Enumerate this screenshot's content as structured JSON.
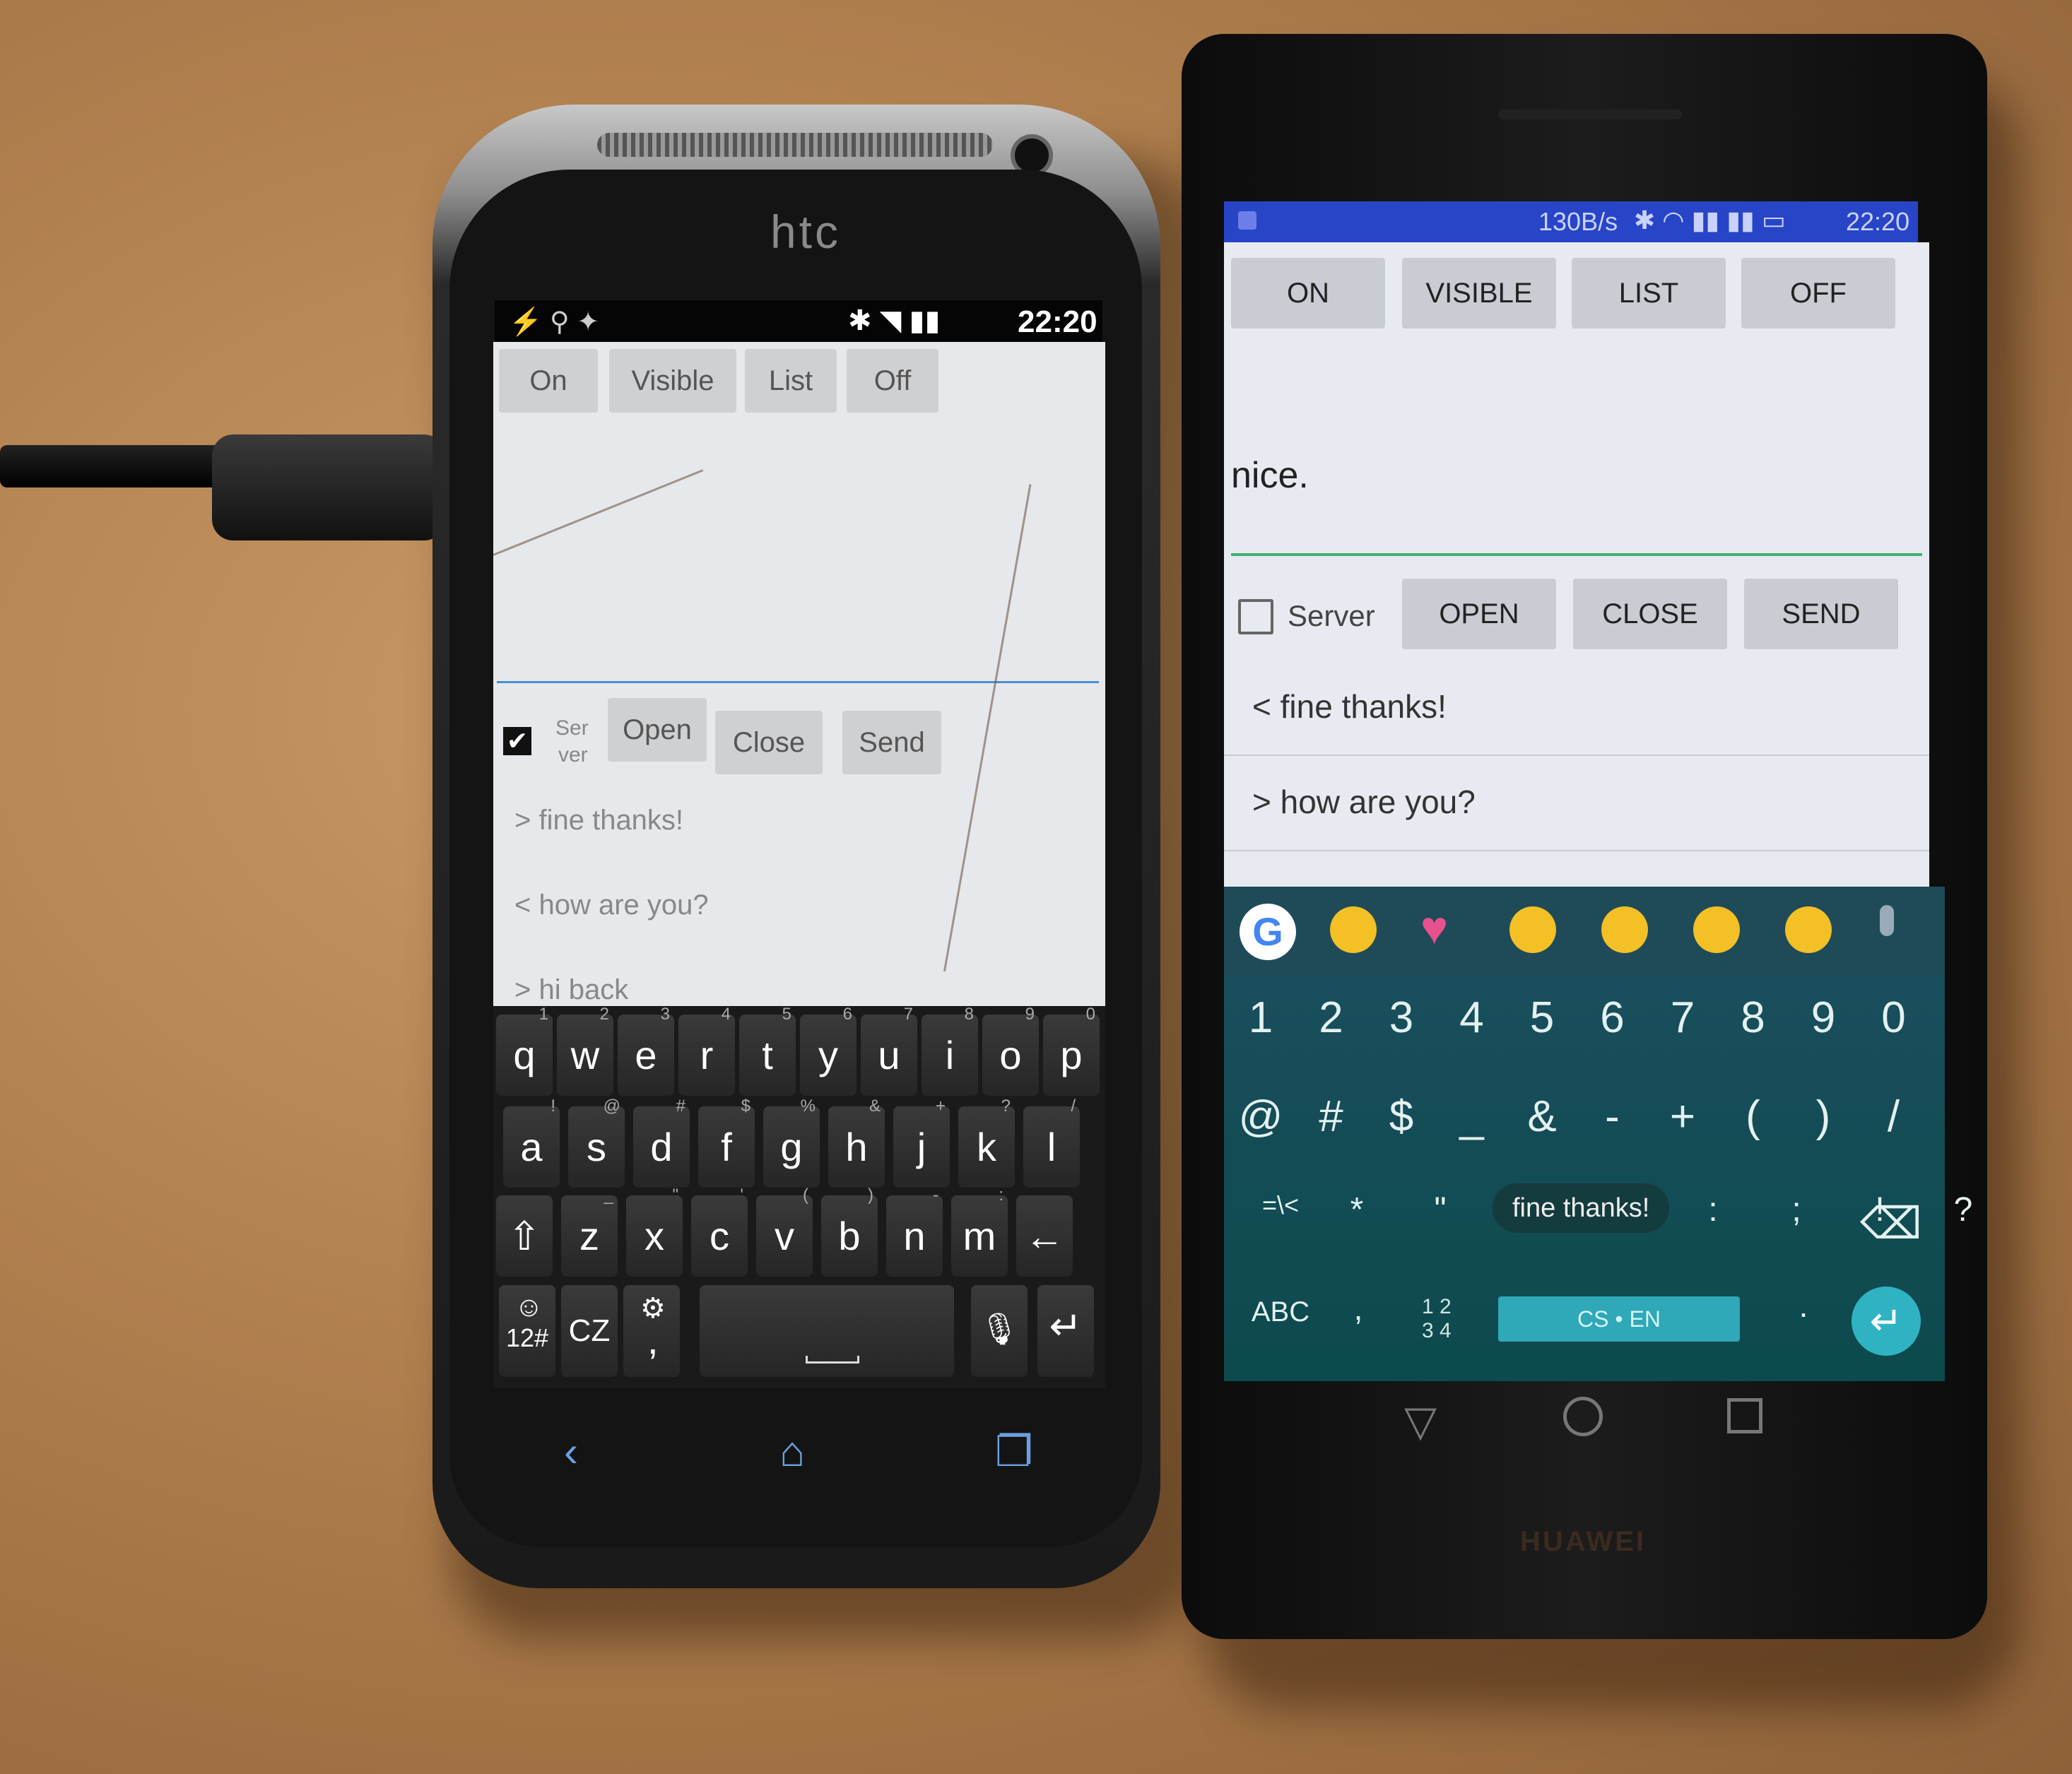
{
  "htc": {
    "brand": "htc",
    "status_time": "22:20",
    "buttons": {
      "on": "On",
      "visible": "Visible",
      "list": "List",
      "off": "Off"
    },
    "server_label_top": "Ser",
    "server_label_bottom": "ver",
    "server_checked": true,
    "actions": {
      "open": "Open",
      "close": "Close",
      "send": "Send"
    },
    "messages": [
      "> fine thanks!",
      "< how are you?",
      "> hi back"
    ],
    "keyboard": {
      "row1": [
        {
          "k": "q",
          "s": "1"
        },
        {
          "k": "w",
          "s": "2"
        },
        {
          "k": "e",
          "s": "3"
        },
        {
          "k": "r",
          "s": "4"
        },
        {
          "k": "t",
          "s": "5"
        },
        {
          "k": "y",
          "s": "6"
        },
        {
          "k": "u",
          "s": "7"
        },
        {
          "k": "i",
          "s": "8"
        },
        {
          "k": "o",
          "s": "9"
        },
        {
          "k": "p",
          "s": "0"
        }
      ],
      "row2": [
        {
          "k": "a",
          "s": "!"
        },
        {
          "k": "s",
          "s": "@"
        },
        {
          "k": "d",
          "s": "#"
        },
        {
          "k": "f",
          "s": "$"
        },
        {
          "k": "g",
          "s": "%"
        },
        {
          "k": "h",
          "s": "&"
        },
        {
          "k": "j",
          "s": "+"
        },
        {
          "k": "k",
          "s": "?"
        },
        {
          "k": "l",
          "s": "/"
        }
      ],
      "row3": [
        {
          "k": "⇧",
          "s": ""
        },
        {
          "k": "z",
          "s": "_"
        },
        {
          "k": "x",
          "s": "\""
        },
        {
          "k": "c",
          "s": "'"
        },
        {
          "k": "v",
          "s": "("
        },
        {
          "k": "b",
          "s": ")"
        },
        {
          "k": "n",
          "s": "-"
        },
        {
          "k": "m",
          "s": ":"
        },
        {
          "k": "←",
          "s": ""
        }
      ],
      "sym_key": "12#",
      "lang_key": "CZ",
      "comma_key": ","
    }
  },
  "huawei": {
    "brand": "HUAWEI",
    "status_text": "130B/s",
    "status_time": "22:20",
    "buttons": {
      "on": "ON",
      "visible": "VISIBLE",
      "list": "LIST",
      "off": "OFF"
    },
    "input_value": "nice.",
    "server_label": "Server",
    "server_checked": false,
    "actions": {
      "open": "OPEN",
      "close": "CLOSE",
      "send": "SEND"
    },
    "messages": [
      "< fine thanks!",
      "> how are you?"
    ],
    "keyboard": {
      "numbers": [
        "1",
        "2",
        "3",
        "4",
        "5",
        "6",
        "7",
        "8",
        "9",
        "0"
      ],
      "symbols_row": [
        "@",
        "#",
        "$",
        "_",
        "&",
        "-",
        "+",
        "(",
        ")",
        "/"
      ],
      "row3": [
        "=\\<",
        "*",
        "\"",
        "'",
        ":",
        ";",
        "!",
        "?"
      ],
      "popup": "fine thanks!",
      "abc": "ABC",
      "comma": ",",
      "num_top": "1 2",
      "num_bottom": "3 4",
      "space": "CS • EN",
      "period": "."
    },
    "accent_color": "#2fa8b8"
  }
}
